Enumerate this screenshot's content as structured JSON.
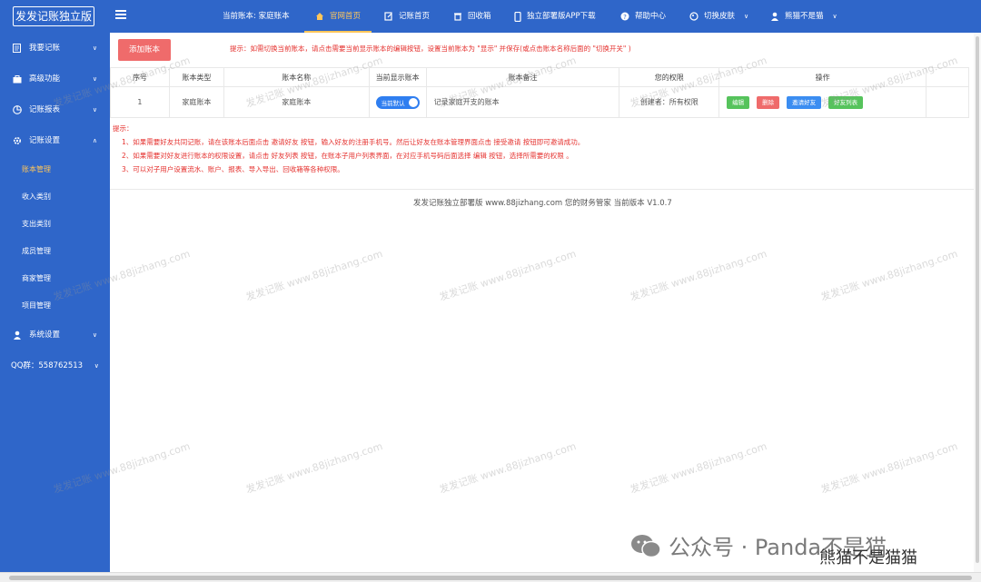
{
  "app": {
    "title": "发发记账独立版"
  },
  "header": {
    "current_book": "当前账本: 家庭账本",
    "nav": [
      {
        "label": "官网首页",
        "icon": "home-icon"
      },
      {
        "label": "记账首页",
        "icon": "edit-icon"
      },
      {
        "label": "回收箱",
        "icon": "trash-icon"
      },
      {
        "label": "独立部署版APP下载",
        "icon": "phone-icon"
      },
      {
        "label": "帮助中心",
        "icon": "help-icon"
      },
      {
        "label": "切换皮肤",
        "icon": "palette-icon"
      },
      {
        "label": "熊猫不是猫",
        "icon": "user-icon"
      }
    ]
  },
  "sidebar": {
    "menus": [
      {
        "label": "我要记账",
        "icon": "book-icon"
      },
      {
        "label": "高级功能",
        "icon": "briefcase-icon"
      },
      {
        "label": "记账报表",
        "icon": "pie-chart-icon"
      },
      {
        "label": "记账设置",
        "icon": "gear-icon"
      }
    ],
    "subs": [
      "账本管理",
      "收入类别",
      "支出类别",
      "成员管理",
      "商家管理",
      "项目管理"
    ],
    "system": {
      "label": "系统设置",
      "icon": "user-icon"
    },
    "qq": "QQ群：558762513"
  },
  "main": {
    "add_button": "添加账本",
    "tip_top": "提示：如需切换当前账本，请点击需要当前显示账本的编辑按钮，设置当前账本为 \"显示\" 并保存(或点击账本名称后面的 \"切换开关\" )",
    "table": {
      "headers": [
        "序号",
        "账本类型",
        "账本名称",
        "当前显示账本",
        "账本备注",
        "您的权限",
        "操作"
      ],
      "row": {
        "index": "1",
        "type": "家庭账本",
        "name": "家庭账本",
        "toggle": "当前默认",
        "note": "记录家庭开支的账本",
        "permission": "创建者：所有权限",
        "ops": [
          "编辑",
          "删除",
          "邀请好友",
          "好友列表"
        ]
      }
    },
    "tips": {
      "title": "提示：",
      "lines": [
        "1、如果需要好友共同记账，请在该账本后面点击 邀请好友 按钮，输入好友的注册手机号。然后让好友在账本管理界面点击 接受邀请 按钮即可邀请成功。",
        "2、如果需要对好友进行账本的权限设置，请点击 好友列表 按钮，在账本子用户列表界面，在对应手机号码后面选择 编辑 按钮，选择所需要的权限 。",
        "3、可以对子用户设置流水、账户、报表、导入导出、回收箱等各种权限。"
      ]
    },
    "footer": "发发记账独立部署版   www.88jizhang.com   您的财务管家   当前版本 V1.0.7"
  },
  "watermark": "发发记账 www.88jizhang.com",
  "overlay": {
    "wechat": "公众号 · Panda不是猫",
    "author": "熊猫不是猫猫"
  }
}
